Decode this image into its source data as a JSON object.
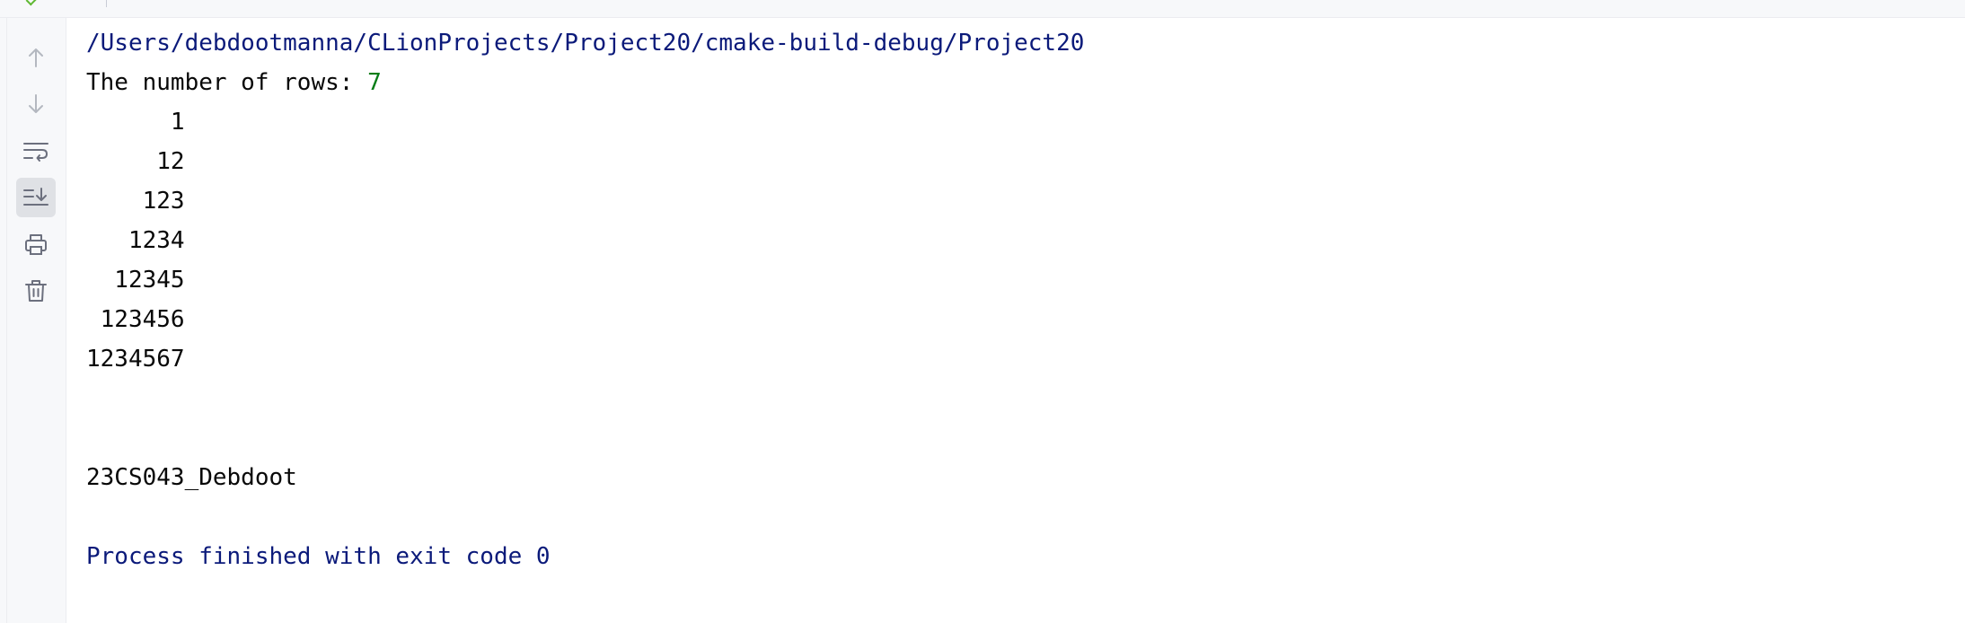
{
  "toolbar": {
    "buttons": [
      {
        "icon": "arrow-up-icon",
        "label": "Up the stack trace",
        "enabled": false
      },
      {
        "icon": "arrow-down-icon",
        "label": "Down the stack trace",
        "enabled": false
      },
      {
        "icon": "soft-wrap-icon",
        "label": "Soft-Wrap",
        "enabled": true
      },
      {
        "icon": "scroll-to-end-icon",
        "label": "Scroll to the end",
        "enabled": true,
        "active": true
      },
      {
        "icon": "print-icon",
        "label": "Print",
        "enabled": true
      },
      {
        "icon": "trash-icon",
        "label": "Clear All",
        "enabled": true
      }
    ]
  },
  "console": {
    "path": "/Users/debdootmanna/CLionProjects/Project20/cmake-build-debug/Project20",
    "prompt": "The number of rows: ",
    "input_value": "7",
    "pattern_rows": [
      "      1",
      "     12",
      "    123",
      "   1234",
      "  12345",
      " 123456",
      "1234567"
    ],
    "signature": "23CS043_Debdoot",
    "exit_message": "Process finished with exit code 0"
  },
  "colors": {
    "path_text": "#0b1a7a",
    "input_text": "#067d17",
    "output_text": "#080808",
    "toolbar_bg": "#f7f8fa",
    "active_button_bg": "#dfe1e5"
  }
}
